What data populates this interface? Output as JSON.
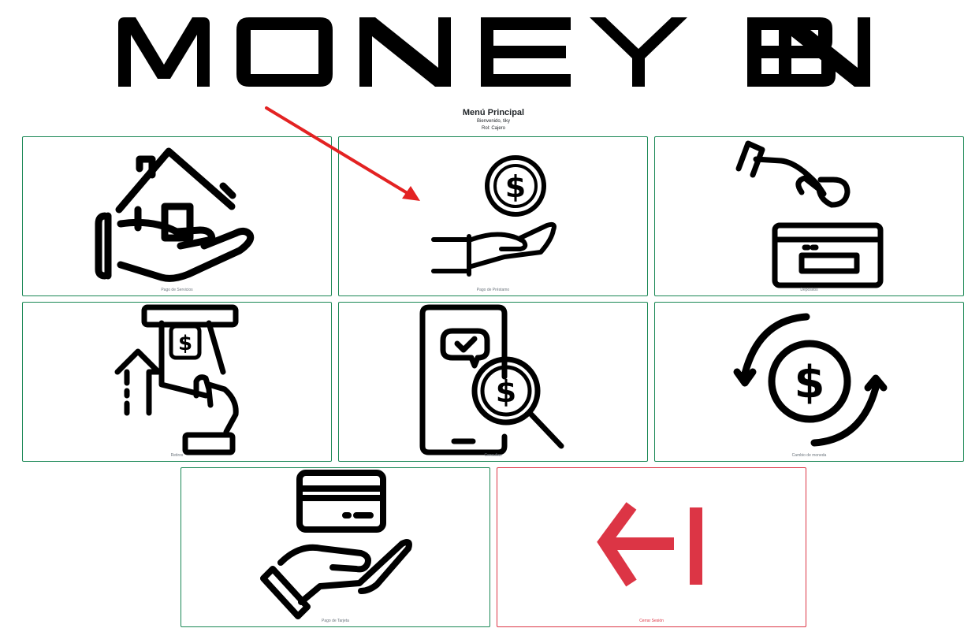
{
  "brand": {
    "logo_text": "MONEY BIN"
  },
  "header": {
    "title": "Menú Principal",
    "welcome": "Bienvenido, tiky",
    "role": "Rol: Cajero"
  },
  "tiles": [
    {
      "label": "Pago de Servicios",
      "icon": "house-in-hand-icon"
    },
    {
      "label": "Pago de Préstamo",
      "icon": "coin-over-hand-icon"
    },
    {
      "label": "Depositos",
      "icon": "hand-deposit-coin-icon"
    },
    {
      "label": "Retiros",
      "icon": "atm-cash-withdraw-icon"
    },
    {
      "label": "Consultas",
      "icon": "phone-search-dollar-icon"
    },
    {
      "label": "Cambio de moneda",
      "icon": "currency-exchange-icon"
    },
    {
      "label": "Pago de Tarjeta",
      "icon": "card-in-hand-icon"
    },
    {
      "label": "Cerrar Sesión",
      "icon": "logout-arrow-icon"
    }
  ],
  "colors": {
    "success": "#198754",
    "danger": "#dc3545",
    "annotation_arrow": "#e32222"
  }
}
